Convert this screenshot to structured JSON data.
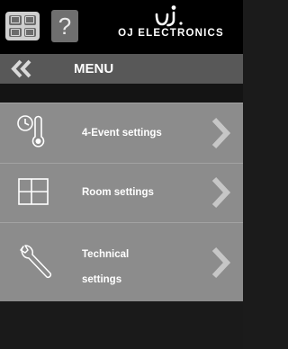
{
  "header": {
    "brand_text": "OJ ELECTRONICS",
    "logo_mark": "OJ",
    "help_label": "?"
  },
  "menubar": {
    "title": "MENU"
  },
  "menu_items": [
    {
      "label": "4-Event settings",
      "icon": "clock-thermometer-icon"
    },
    {
      "label": "Room settings",
      "icon": "room-grid-icon"
    },
    {
      "label_line1": "Technical",
      "label_line2": "settings",
      "icon": "wrench-icon"
    }
  ],
  "colors": {
    "topbar": "#000000",
    "menubar": "#585858",
    "item_bg": "#8c8c8c",
    "chevron": "#c6c6c6"
  }
}
